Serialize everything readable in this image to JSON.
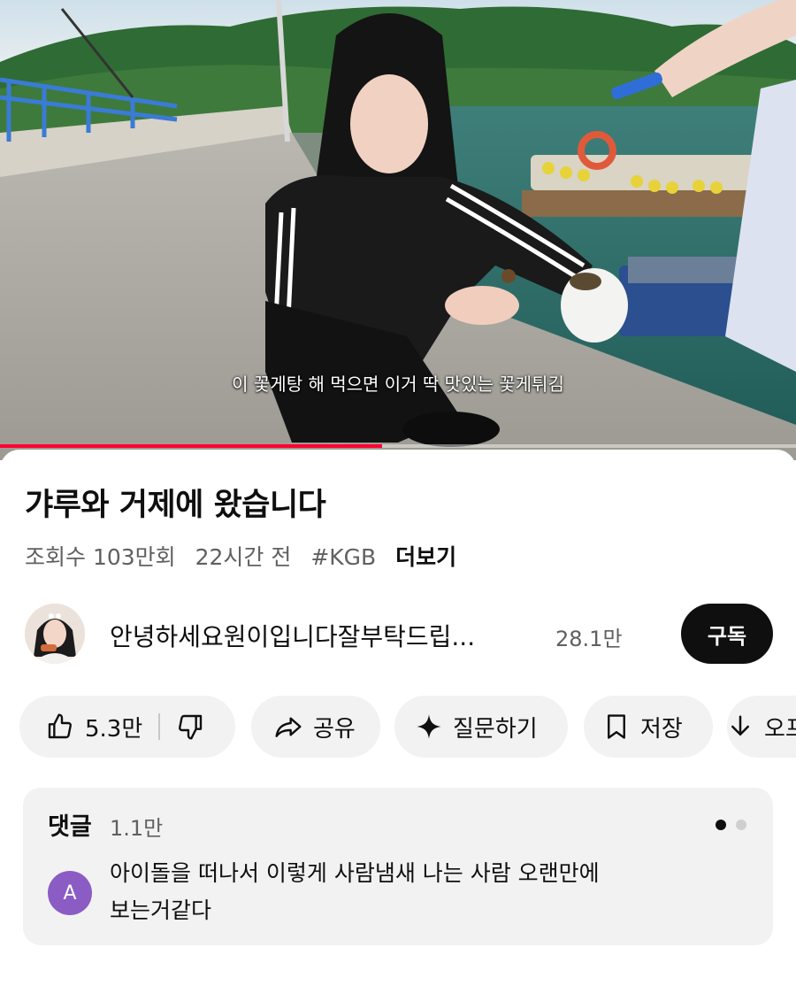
{
  "video": {
    "subtitle": "이 꽃게탕 해 먹으면 이거 딱 맛있는 꽃게튀김",
    "progress_fraction": 0.48,
    "progress_color": "#ff0033"
  },
  "title": "갸루와 거제에 왔습니다",
  "meta": {
    "views": "조회수 103만회",
    "time": "22시간 전",
    "hashtag": "#KGB",
    "more": "더보기"
  },
  "channel": {
    "name": "안녕하세요원이입니다잘부탁드립...",
    "subscribers": "28.1만",
    "subscribe_label": "구독"
  },
  "actions": {
    "like_count": "5.3만",
    "share": "공유",
    "ask": "질문하기",
    "save": "저장",
    "download": "오프라인 저장"
  },
  "icons": [
    "thumb-up-icon",
    "thumb-down-icon",
    "share-arrow-icon",
    "sparkle-icon",
    "bookmark-icon",
    "download-icon"
  ],
  "comments": {
    "header": "댓글",
    "count": "1.1만",
    "top_comment": {
      "avatar_letter": "A",
      "text_line1": "아이돌을 떠나서 이렇게 사람냄새 나는 사람 오랜만에",
      "text_line2": "보는거같다"
    }
  },
  "colors": {
    "subscribe_bg": "#0f0f0f",
    "pill_bg": "#f2f2f2",
    "comment_avatar": "#8a5cc4"
  }
}
